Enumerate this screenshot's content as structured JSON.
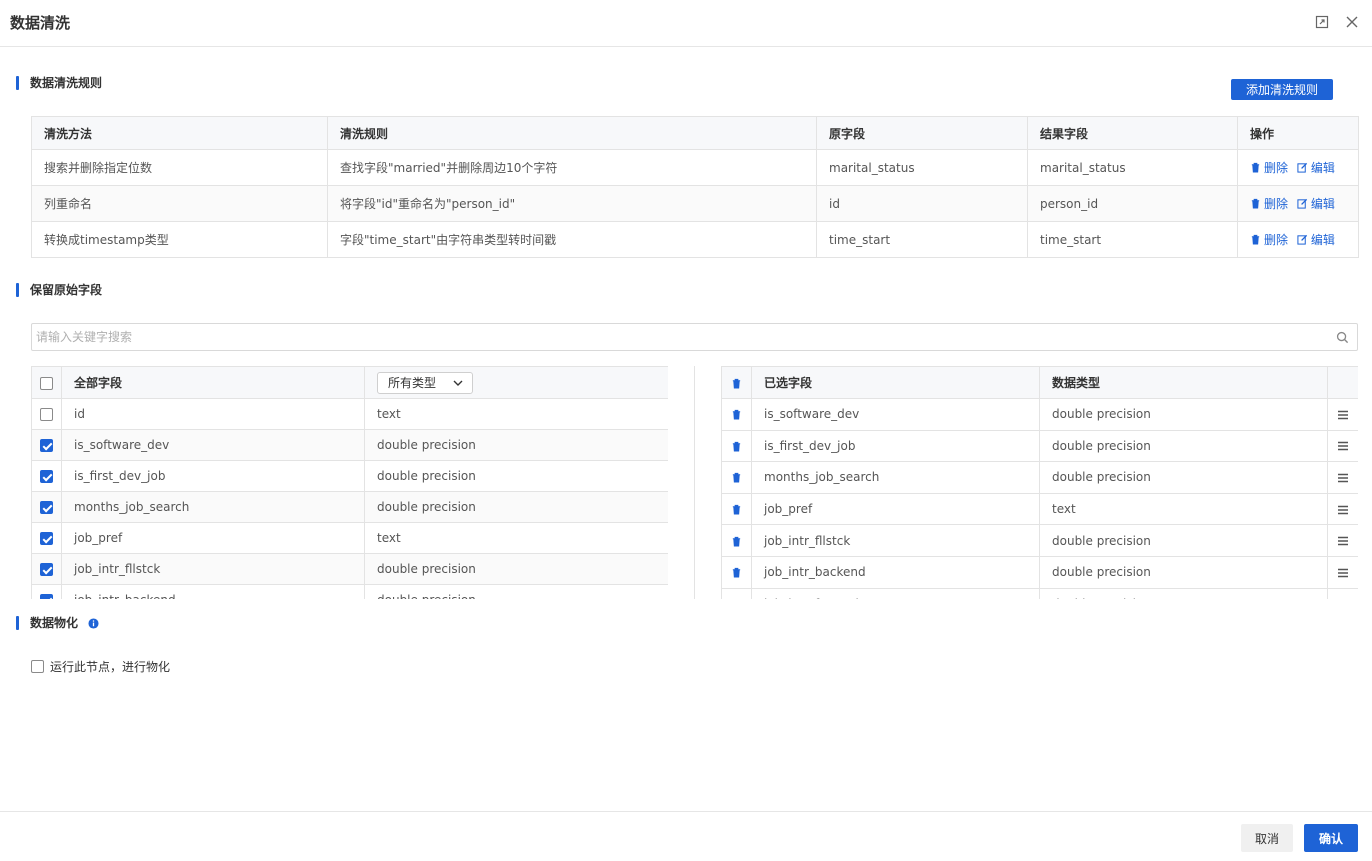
{
  "dialog": {
    "title": "数据清洗"
  },
  "rules_section": {
    "title": "数据清洗规则",
    "add_button": "添加清洗规则",
    "columns": [
      "清洗方法",
      "清洗规则",
      "原字段",
      "结果字段",
      "操作"
    ],
    "rows": [
      {
        "method": "搜索并删除指定位数",
        "rule": "查找字段\"married\"并删除周边10个字符",
        "source": "marital_status",
        "result": "marital_status"
      },
      {
        "method": "列重命名",
        "rule": "将字段\"id\"重命名为\"person_id\"",
        "source": "id",
        "result": "person_id"
      },
      {
        "method": "转换成timestamp类型",
        "rule": "字段\"time_start\"由字符串类型转时间戳",
        "source": "time_start",
        "result": "time_start"
      }
    ],
    "delete_label": "删除",
    "edit_label": "编辑"
  },
  "fields_section": {
    "title": "保留原始字段",
    "search_placeholder": "请输入关键字搜索",
    "all_fields_header": "全部字段",
    "type_select": "所有类型",
    "all_fields": [
      {
        "name": "id",
        "type": "text",
        "checked": false
      },
      {
        "name": "is_software_dev",
        "type": "double precision",
        "checked": true
      },
      {
        "name": "is_first_dev_job",
        "type": "double precision",
        "checked": true
      },
      {
        "name": "months_job_search",
        "type": "double precision",
        "checked": true
      },
      {
        "name": "job_pref",
        "type": "text",
        "checked": true
      },
      {
        "name": "job_intr_fllstck",
        "type": "double precision",
        "checked": true
      },
      {
        "name": "job_intr_backend",
        "type": "double precision",
        "checked": true
      }
    ],
    "selected_header": "已选字段",
    "datatype_header": "数据类型",
    "selected_fields": [
      {
        "name": "is_software_dev",
        "type": "double precision"
      },
      {
        "name": "is_first_dev_job",
        "type": "double precision"
      },
      {
        "name": "months_job_search",
        "type": "double precision"
      },
      {
        "name": "job_pref",
        "type": "text"
      },
      {
        "name": "job_intr_fllstck",
        "type": "double precision"
      },
      {
        "name": "job_intr_backend",
        "type": "double precision"
      },
      {
        "name": "job_intr_frntend",
        "type": "double precision"
      }
    ]
  },
  "materialize_section": {
    "title": "数据物化",
    "checkbox_label": "运行此节点，进行物化"
  },
  "footer": {
    "cancel": "取消",
    "confirm": "确认"
  },
  "colors": {
    "accent": "#1e63d6"
  }
}
